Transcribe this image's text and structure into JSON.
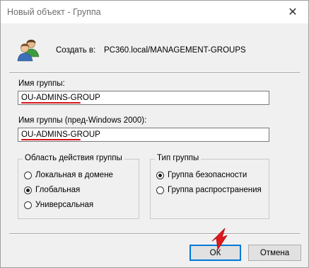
{
  "window": {
    "title": "Новый объект - Группа",
    "close_glyph": "✕"
  },
  "header": {
    "icon": "group-users-icon",
    "create_label": "Создать в:",
    "create_path": "PC360.local/MANAGEMENT-GROUPS"
  },
  "group_name": {
    "label": "Имя группы:",
    "value": "OU-ADMINS-GROUP"
  },
  "group_name_pre2000": {
    "label": "Имя группы (пред-Windows 2000):",
    "value": "OU-ADMINS-GROUP"
  },
  "scope": {
    "title": "Область действия группы",
    "options": [
      {
        "label": "Локальная в домене",
        "selected": false
      },
      {
        "label": "Глобальная",
        "selected": true
      },
      {
        "label": "Универсальная",
        "selected": false
      }
    ]
  },
  "type": {
    "title": "Тип группы",
    "options": [
      {
        "label": "Группа безопасности",
        "selected": true
      },
      {
        "label": "Группа распространения",
        "selected": false
      }
    ]
  },
  "buttons": {
    "ok": "ОК",
    "cancel": "Отмена"
  },
  "colors": {
    "annotation_red": "#d4161c",
    "focus_blue": "#0078d7"
  }
}
